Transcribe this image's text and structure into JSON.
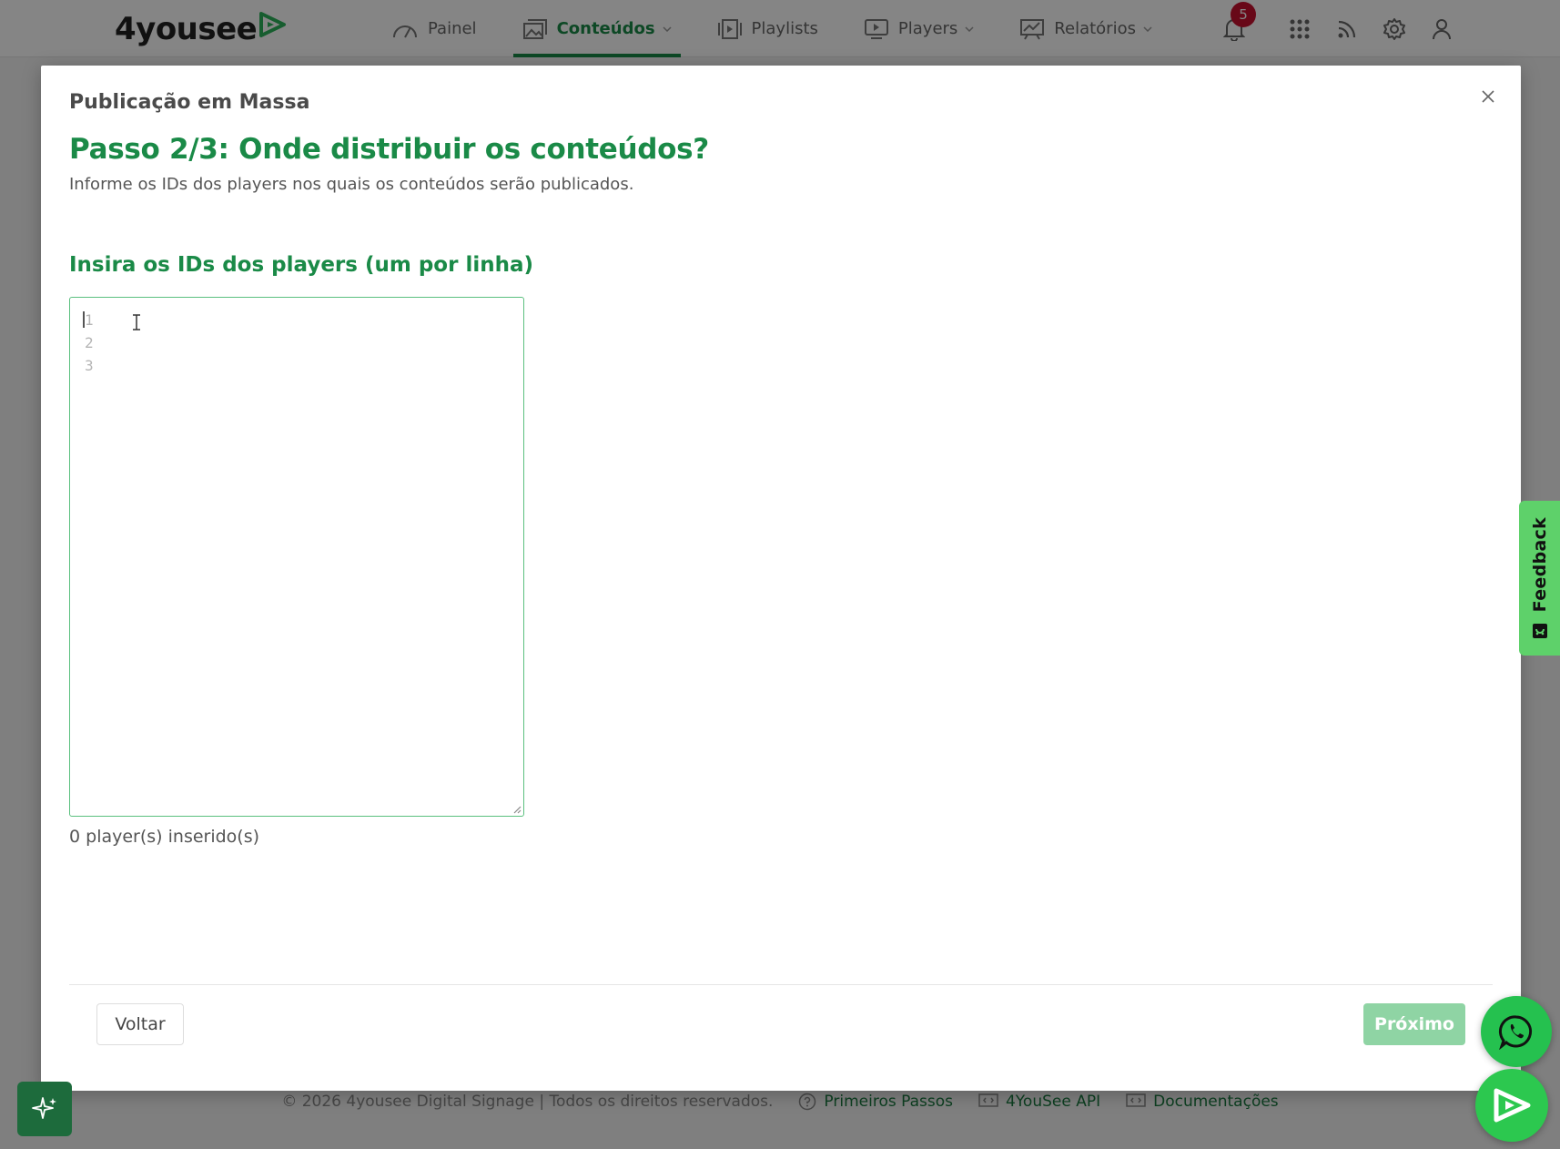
{
  "nav": {
    "logo_text": "4yousee",
    "items": [
      {
        "label": "Painel"
      },
      {
        "label": "Conteúdos"
      },
      {
        "label": "Playlists"
      },
      {
        "label": "Players"
      },
      {
        "label": "Relatórios"
      }
    ],
    "notification_count": "5"
  },
  "modal": {
    "title": "Publicação em Massa",
    "step_title": "Passo 2/3: Onde distribuir os conteúdos?",
    "step_description": "Informe os IDs dos players nos quais os conteúdos serão publicados.",
    "field_label": "Insira os IDs dos players (um por linha)",
    "line_numbers": [
      "1",
      "2",
      "3"
    ],
    "player_count": "0 player(s) inserido(s)",
    "back_label": "Voltar",
    "next_label": "Próximo"
  },
  "footer": {
    "copyright": "© 2026 4yousee Digital Signage | Todos os direitos reservados.",
    "links": [
      {
        "label": "Primeiros Passos"
      },
      {
        "label": "4YouSee API"
      },
      {
        "label": "Documentações"
      }
    ]
  },
  "widgets": {
    "feedback_label": "Feedback"
  },
  "colors": {
    "brand_green": "#1a8a47",
    "editor_border": "#5bc07f",
    "next_button_disabled": "#8fd4a4",
    "badge_red": "#c8102e",
    "feedback_green": "#5ed16a"
  }
}
